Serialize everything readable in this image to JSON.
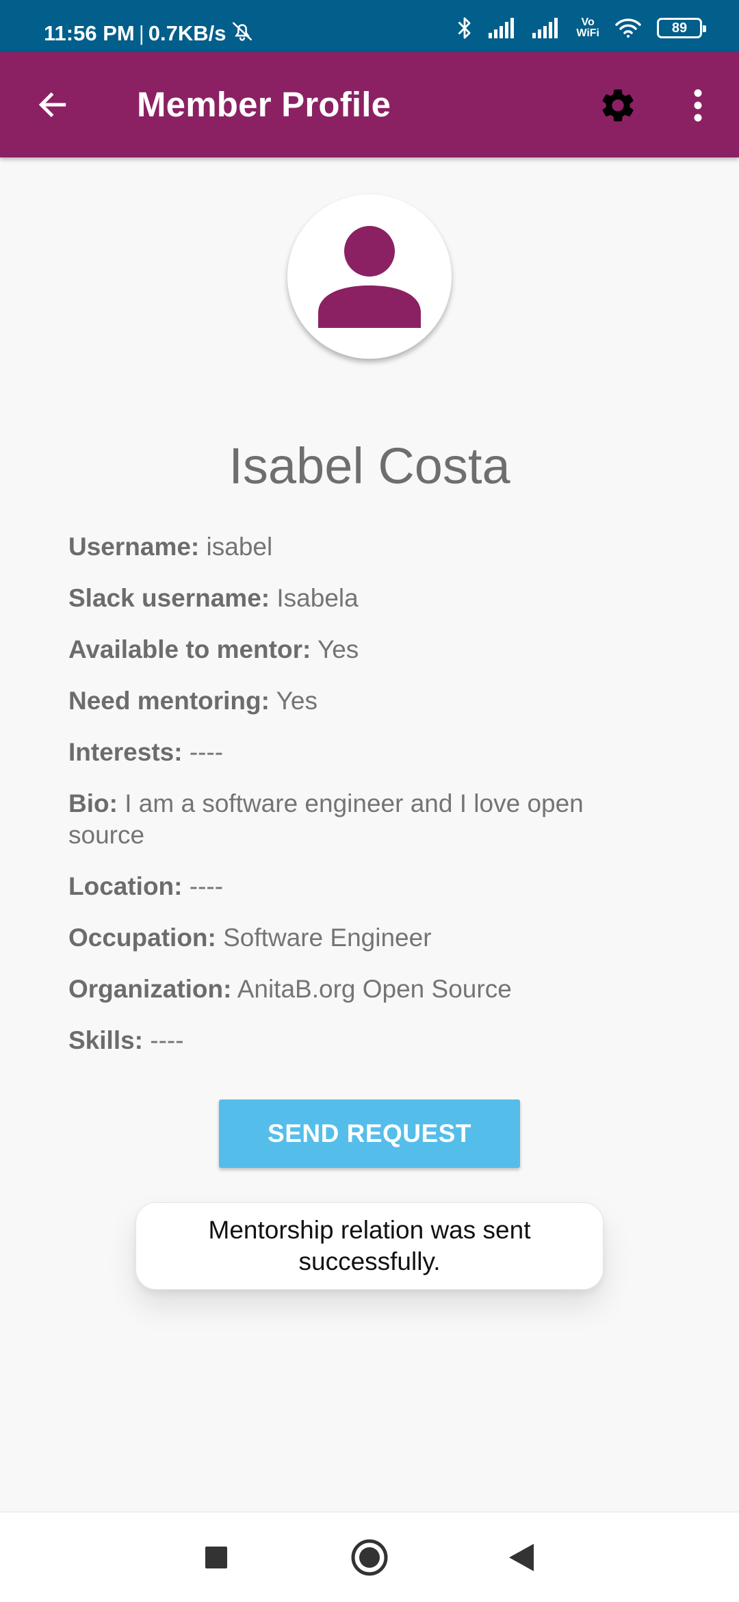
{
  "status_bar": {
    "time": "11:56 PM",
    "separator": "|",
    "network_speed": "0.7KB/s",
    "volte_line1": "Vo",
    "volte_line2": "WiFi",
    "battery_level": "89",
    "icons": [
      "alarm-off-icon",
      "bluetooth-icon",
      "signal-icon",
      "signal-icon",
      "wifi-icon",
      "battery-icon"
    ]
  },
  "app_bar": {
    "title": "Member Profile",
    "icons": [
      "back-arrow-icon",
      "gear-icon",
      "more-vert-icon"
    ]
  },
  "profile": {
    "name": "Isabel Costa",
    "details": [
      {
        "label": "Username:",
        "value": "isabel"
      },
      {
        "label": "Slack username:",
        "value": "Isabela"
      },
      {
        "label": "Available to mentor:",
        "value": "Yes"
      },
      {
        "label": "Need mentoring:",
        "value": "Yes"
      },
      {
        "label": "Interests:",
        "value": "----"
      },
      {
        "label": "Bio:",
        "value": "I am a software engineer and I love open source"
      },
      {
        "label": "Location:",
        "value": "----"
      },
      {
        "label": "Occupation:",
        "value": "Software Engineer"
      },
      {
        "label": "Organization:",
        "value": "AnitaB.org Open Source"
      },
      {
        "label": "Skills:",
        "value": "----"
      }
    ]
  },
  "actions": {
    "send_request_label": "SEND REQUEST"
  },
  "toast": {
    "message": "Mentorship relation was sent successfully."
  },
  "nav_bar": {
    "icons": [
      "recents-square-icon",
      "home-circle-icon",
      "back-triangle-icon"
    ]
  },
  "colors": {
    "status_bar": "#025e8a",
    "app_bar": "#8b2163",
    "avatar_accent": "#8b2163",
    "button": "#55bdea",
    "background": "#f8f8f8"
  }
}
